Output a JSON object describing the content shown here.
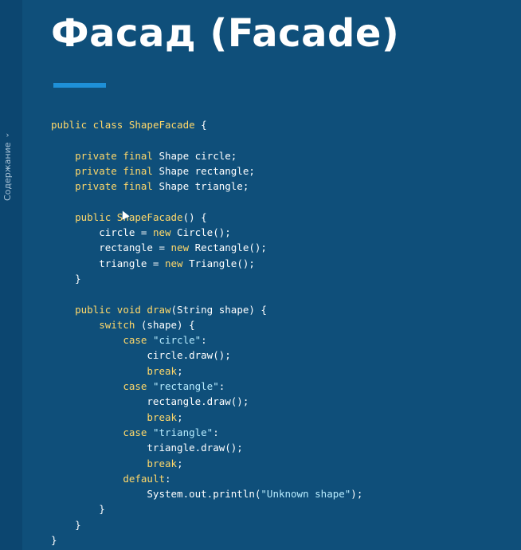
{
  "sidebar": {
    "tab_label": "Содержание",
    "chevron_glyph": "›"
  },
  "slide": {
    "title": "Фасад (Facade)",
    "accent_color": "#1e90d8",
    "background_color": "#0f4f7a"
  },
  "code": {
    "lines": [
      [
        [
          "kw",
          "public class "
        ],
        [
          "cls",
          "ShapeFacade"
        ],
        [
          "txt",
          " {"
        ]
      ],
      [],
      [
        [
          "txt",
          "    "
        ],
        [
          "kw",
          "private final "
        ],
        [
          "txt",
          "Shape circle;"
        ]
      ],
      [
        [
          "txt",
          "    "
        ],
        [
          "kw",
          "private final "
        ],
        [
          "txt",
          "Shape rectangle;"
        ]
      ],
      [
        [
          "txt",
          "    "
        ],
        [
          "kw",
          "private final "
        ],
        [
          "txt",
          "Shape triangle;"
        ]
      ],
      [],
      [
        [
          "txt",
          "    "
        ],
        [
          "kw",
          "public "
        ],
        [
          "fn",
          "ShapeFacade"
        ],
        [
          "txt",
          "() {"
        ]
      ],
      [
        [
          "txt",
          "        circle = "
        ],
        [
          "kw",
          "new "
        ],
        [
          "txt",
          "Circle();"
        ]
      ],
      [
        [
          "txt",
          "        rectangle = "
        ],
        [
          "kw",
          "new "
        ],
        [
          "txt",
          "Rectangle();"
        ]
      ],
      [
        [
          "txt",
          "        triangle = "
        ],
        [
          "kw",
          "new "
        ],
        [
          "txt",
          "Triangle();"
        ]
      ],
      [
        [
          "txt",
          "    }"
        ]
      ],
      [],
      [
        [
          "txt",
          "    "
        ],
        [
          "kw",
          "public void "
        ],
        [
          "fn",
          "draw"
        ],
        [
          "txt",
          "(String shape) {"
        ]
      ],
      [
        [
          "txt",
          "        "
        ],
        [
          "kw",
          "switch "
        ],
        [
          "txt",
          "(shape) {"
        ]
      ],
      [
        [
          "txt",
          "            "
        ],
        [
          "kw",
          "case "
        ],
        [
          "str",
          "\"circle\""
        ],
        [
          "txt",
          ":"
        ]
      ],
      [
        [
          "txt",
          "                circle.draw();"
        ]
      ],
      [
        [
          "txt",
          "                "
        ],
        [
          "kw",
          "break"
        ],
        [
          "txt",
          ";"
        ]
      ],
      [
        [
          "txt",
          "            "
        ],
        [
          "kw",
          "case "
        ],
        [
          "str",
          "\"rectangle\""
        ],
        [
          "txt",
          ":"
        ]
      ],
      [
        [
          "txt",
          "                rectangle.draw();"
        ]
      ],
      [
        [
          "txt",
          "                "
        ],
        [
          "kw",
          "break"
        ],
        [
          "txt",
          ";"
        ]
      ],
      [
        [
          "txt",
          "            "
        ],
        [
          "kw",
          "case "
        ],
        [
          "str",
          "\"triangle\""
        ],
        [
          "txt",
          ":"
        ]
      ],
      [
        [
          "txt",
          "                triangle.draw();"
        ]
      ],
      [
        [
          "txt",
          "                "
        ],
        [
          "kw",
          "break"
        ],
        [
          "txt",
          ";"
        ]
      ],
      [
        [
          "txt",
          "            "
        ],
        [
          "kw",
          "default"
        ],
        [
          "txt",
          ":"
        ]
      ],
      [
        [
          "txt",
          "                System.out.println("
        ],
        [
          "str",
          "\"Unknown shape\""
        ],
        [
          "txt",
          ");"
        ]
      ],
      [
        [
          "txt",
          "        }"
        ]
      ],
      [
        [
          "txt",
          "    }"
        ]
      ],
      [
        [
          "txt",
          "}"
        ]
      ]
    ]
  }
}
